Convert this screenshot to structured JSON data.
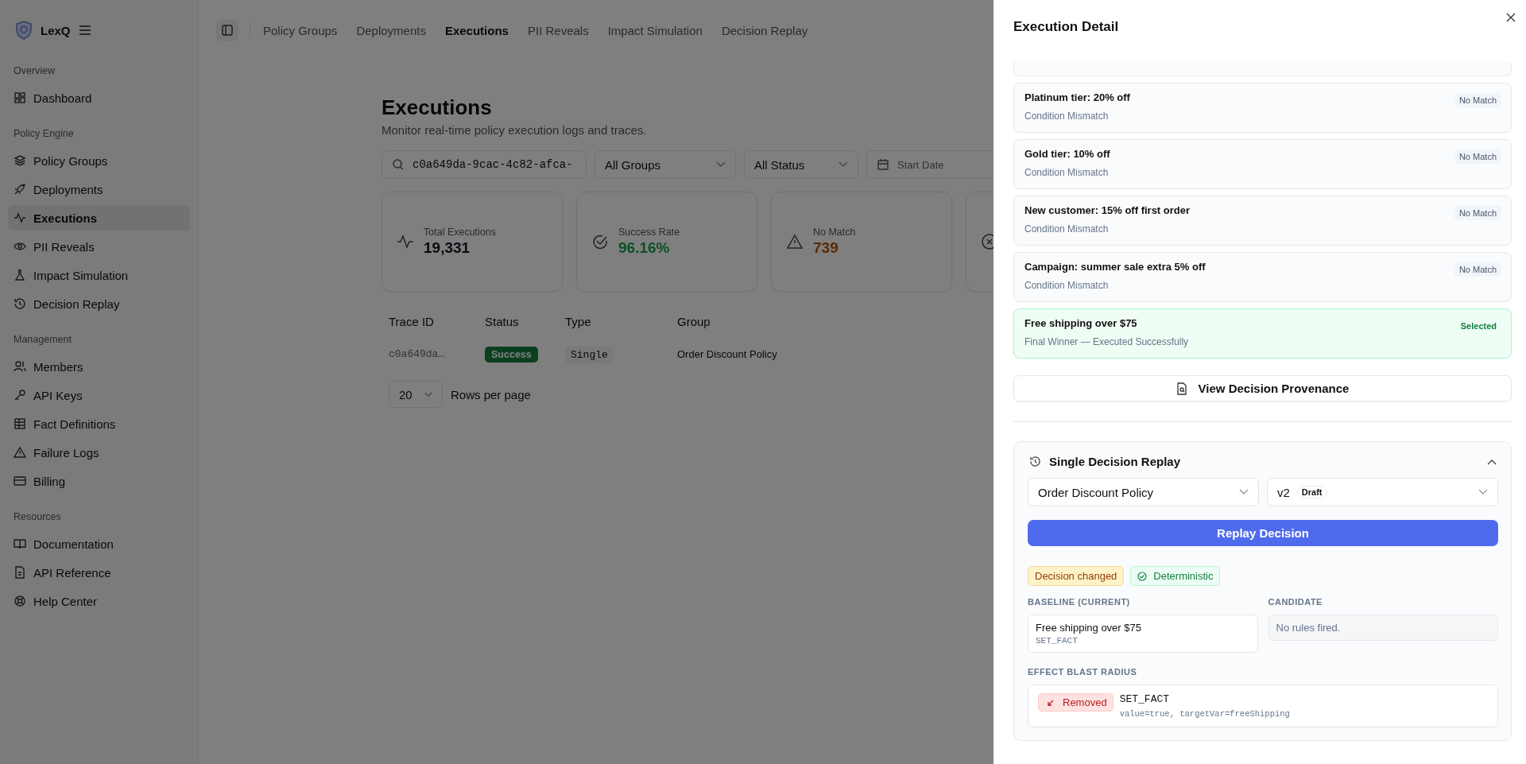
{
  "brand": {
    "name": "LexQ"
  },
  "sidebar": {
    "sections": [
      {
        "title": "Overview",
        "items": [
          {
            "label": "Dashboard",
            "selected": false
          }
        ]
      },
      {
        "title": "Policy Engine",
        "items": [
          {
            "label": "Policy Groups",
            "selected": false
          },
          {
            "label": "Deployments",
            "selected": false
          },
          {
            "label": "Executions",
            "selected": true
          },
          {
            "label": "PII Reveals",
            "selected": false
          },
          {
            "label": "Impact Simulation",
            "selected": false
          },
          {
            "label": "Decision Replay",
            "selected": false
          }
        ]
      },
      {
        "title": "Management",
        "items": [
          {
            "label": "Members",
            "selected": false
          },
          {
            "label": "API Keys",
            "selected": false
          },
          {
            "label": "Fact Definitions",
            "selected": false
          },
          {
            "label": "Failure Logs",
            "selected": false
          },
          {
            "label": "Billing",
            "selected": false
          }
        ]
      },
      {
        "title": "Resources",
        "items": [
          {
            "label": "Documentation",
            "selected": false
          },
          {
            "label": "API Reference",
            "selected": false
          },
          {
            "label": "Help Center",
            "selected": false
          }
        ]
      }
    ]
  },
  "top_tabs": [
    {
      "label": "Policy Groups",
      "selected": false
    },
    {
      "label": "Deployments",
      "selected": false
    },
    {
      "label": "Executions",
      "selected": true
    },
    {
      "label": "PII Reveals",
      "selected": false
    },
    {
      "label": "Impact Simulation",
      "selected": false
    },
    {
      "label": "Decision Replay",
      "selected": false
    }
  ],
  "page": {
    "title": "Executions",
    "subtitle": "Monitor real-time policy execution logs and traces."
  },
  "filters": {
    "search": "c0a649da-9cac-4c82-afca-",
    "group": "All Groups",
    "status": "All Status",
    "start_date": {
      "placeholder": "Start Date"
    }
  },
  "stats": [
    {
      "kind": "activity",
      "label": "Total Executions",
      "value": "19,331"
    },
    {
      "kind": "success",
      "label": "Success Rate",
      "value": "96.16%"
    },
    {
      "kind": "warning",
      "label": "No Match",
      "value": "739"
    },
    {
      "kind": "error"
    }
  ],
  "table": {
    "columns": [
      "Trace ID",
      "Status",
      "Type",
      "Group"
    ],
    "rows": [
      {
        "trace_id": "c0a649da…",
        "status": "Success",
        "type": "Single",
        "group": "Order Discount Policy"
      }
    ]
  },
  "pagination": {
    "page_size": "20",
    "label": "Rows per page"
  },
  "drawer": {
    "title": "Execution Detail",
    "rules": [
      {
        "title": "Platinum tier: 20% off",
        "reason": "Condition Mismatch",
        "status": "No Match",
        "selected": false
      },
      {
        "title": "Gold tier: 10% off",
        "reason": "Condition Mismatch",
        "status": "No Match",
        "selected": false
      },
      {
        "title": "New customer: 15% off first order",
        "reason": "Condition Mismatch",
        "status": "No Match",
        "selected": false
      },
      {
        "title": "Campaign: summer sale extra 5% off",
        "reason": "Condition Mismatch",
        "status": "No Match",
        "selected": false
      },
      {
        "title": "Free shipping over $75",
        "reason": "Final Winner — Executed Successfully",
        "status": "Selected",
        "selected": true
      }
    ],
    "provenance_button": "View Decision Provenance",
    "replay": {
      "title": "Single Decision Replay",
      "expanded": true,
      "policy": "Order Discount Policy",
      "version": "v2",
      "version_badge": "Draft",
      "button": "Replay Decision",
      "badges": [
        {
          "kind": "changed",
          "label": "Decision changed"
        },
        {
          "kind": "deterministic",
          "label": "Deterministic"
        }
      ],
      "baseline": {
        "label": "BASELINE (CURRENT)",
        "rule": "Free shipping over $75",
        "action": "SET_FACT"
      },
      "candidate": {
        "label": "CANDIDATE",
        "empty": "No rules fired."
      },
      "effects_label": "EFFECT BLAST RADIUS",
      "effects": [
        {
          "kind": "removed",
          "badge": "Removed",
          "action": "SET_FACT",
          "params": "value=true, targetVar=freeShipping"
        }
      ]
    }
  }
}
